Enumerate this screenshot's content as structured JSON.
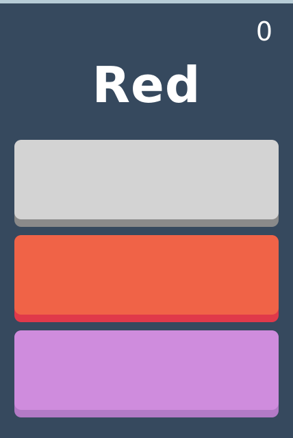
{
  "game": {
    "score": "0",
    "prompt_word": "Red"
  },
  "choices": [
    {
      "id": "choice-1",
      "color_name": "light gray",
      "color": "#d3d3d3",
      "shadow": "#8a8a8a"
    },
    {
      "id": "choice-2",
      "color_name": "red-orange",
      "color": "#f06347",
      "shadow": "#e0394a"
    },
    {
      "id": "choice-3",
      "color_name": "purple",
      "color": "#cf8cdd",
      "shadow": "#b37ac6"
    }
  ],
  "colors": {
    "background": "#36495e",
    "top_strip": "#b7ccd6",
    "text": "#ffffff"
  }
}
